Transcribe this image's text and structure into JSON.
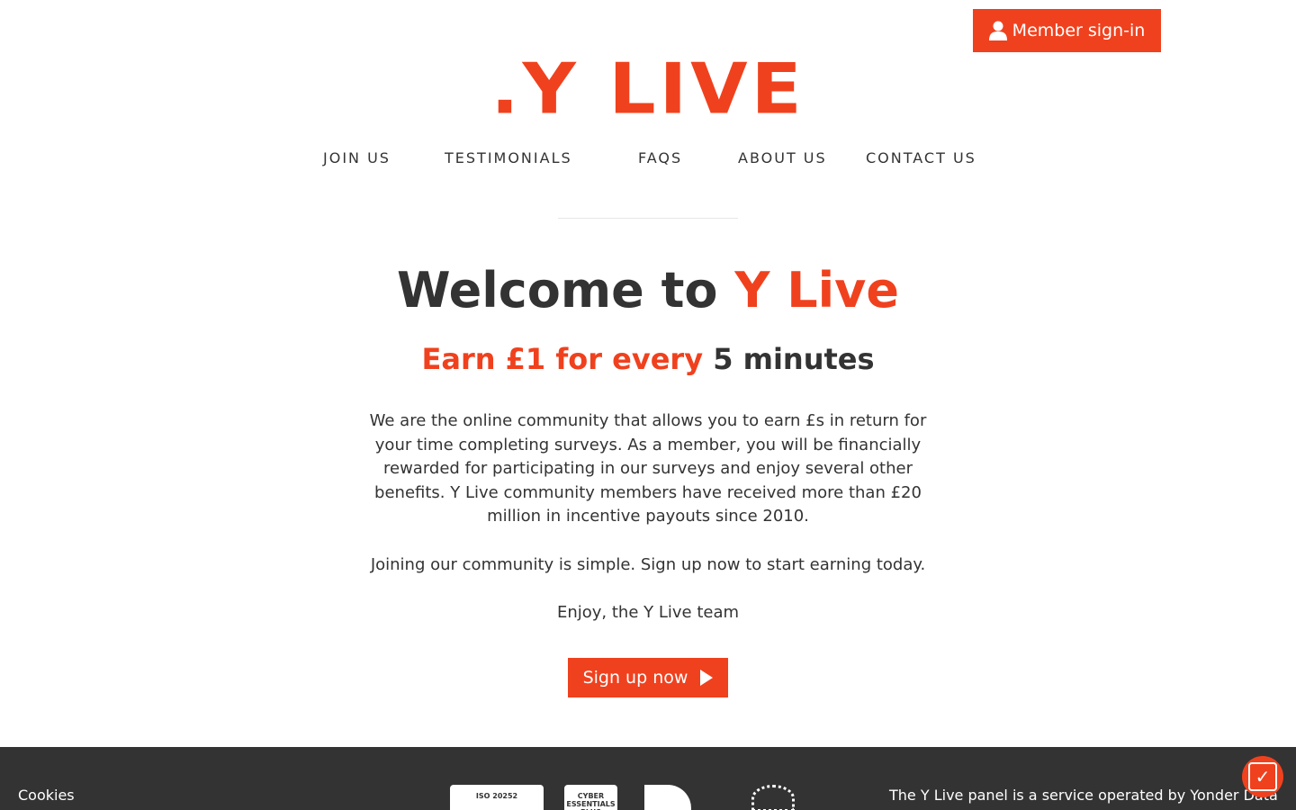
{
  "header": {
    "signin_label": "Member sign-in",
    "signin_icon": "user-icon",
    "logo_text": ".Y LIVE"
  },
  "nav": {
    "items": [
      {
        "label": "JOIN US"
      },
      {
        "label": "TESTIMONIALS"
      },
      {
        "label": "FAQS"
      },
      {
        "label": "ABOUT US"
      },
      {
        "label": "CONTACT US"
      }
    ]
  },
  "hero": {
    "title_prefix": "Welcome to ",
    "title_accent": "Y Live",
    "subtitle_accent": "Earn £1 for every ",
    "subtitle_dark": "5 minutes",
    "paragraph1": "We are the online community that allows you to earn £s in return for your time completing surveys. As a member, you will be financially rewarded for participating in our surveys and enjoy several other benefits. Y Live community members have received more than £20 million in incentive payouts since 2010.",
    "paragraph2": "Joining our community is simple. Sign up now to start earning today.",
    "paragraph3": "Enjoy, the Y Live team",
    "signup_label": "Sign up now",
    "signup_icon": "play-icon"
  },
  "footer": {
    "cookies_label": "Cookies",
    "operated_text": "The Y Live panel is a service operated by Yonder Data",
    "badges": [
      {
        "label": "ISO 20252"
      },
      {
        "label": "CYBER ESSENTIALS PLUS"
      }
    ]
  },
  "colors": {
    "accent": "#f0411e",
    "text": "#333333",
    "footer_bg": "#333333"
  }
}
